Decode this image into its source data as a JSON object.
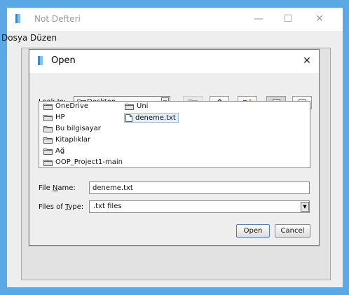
{
  "window": {
    "title": "Not Defteri",
    "minimize_glyph": "—",
    "maximize_glyph": "☐",
    "close_glyph": "✕"
  },
  "menu": {
    "items": [
      "Dosya",
      "Düzen"
    ]
  },
  "dialog": {
    "title": "Open",
    "close_glyph": "✕",
    "look_in_label_prefix": "Look ",
    "look_in_label_mnemonic": "I",
    "look_in_label_suffix": "n:",
    "look_in_value": "Desktop",
    "files": [
      {
        "name": "OneDrive",
        "type": "folder"
      },
      {
        "name": "HP",
        "type": "folder"
      },
      {
        "name": "Bu bilgisayar",
        "type": "folder"
      },
      {
        "name": "Kitaplıklar",
        "type": "folder"
      },
      {
        "name": "Ağ",
        "type": "folder"
      },
      {
        "name": "OOP_Project1-main",
        "type": "folder"
      },
      {
        "name": "Uni",
        "type": "folder"
      },
      {
        "name": "deneme.txt",
        "type": "file",
        "selected": true
      }
    ],
    "file_name_label_prefix": "File ",
    "file_name_label_mnemonic": "N",
    "file_name_label_suffix": "ame:",
    "file_name_value": "deneme.txt",
    "file_type_label_prefix": "Files of ",
    "file_type_label_mnemonic": "T",
    "file_type_label_suffix": "ype:",
    "file_type_value": ".txt files",
    "open_label": "Open",
    "cancel_label": "Cancel"
  }
}
